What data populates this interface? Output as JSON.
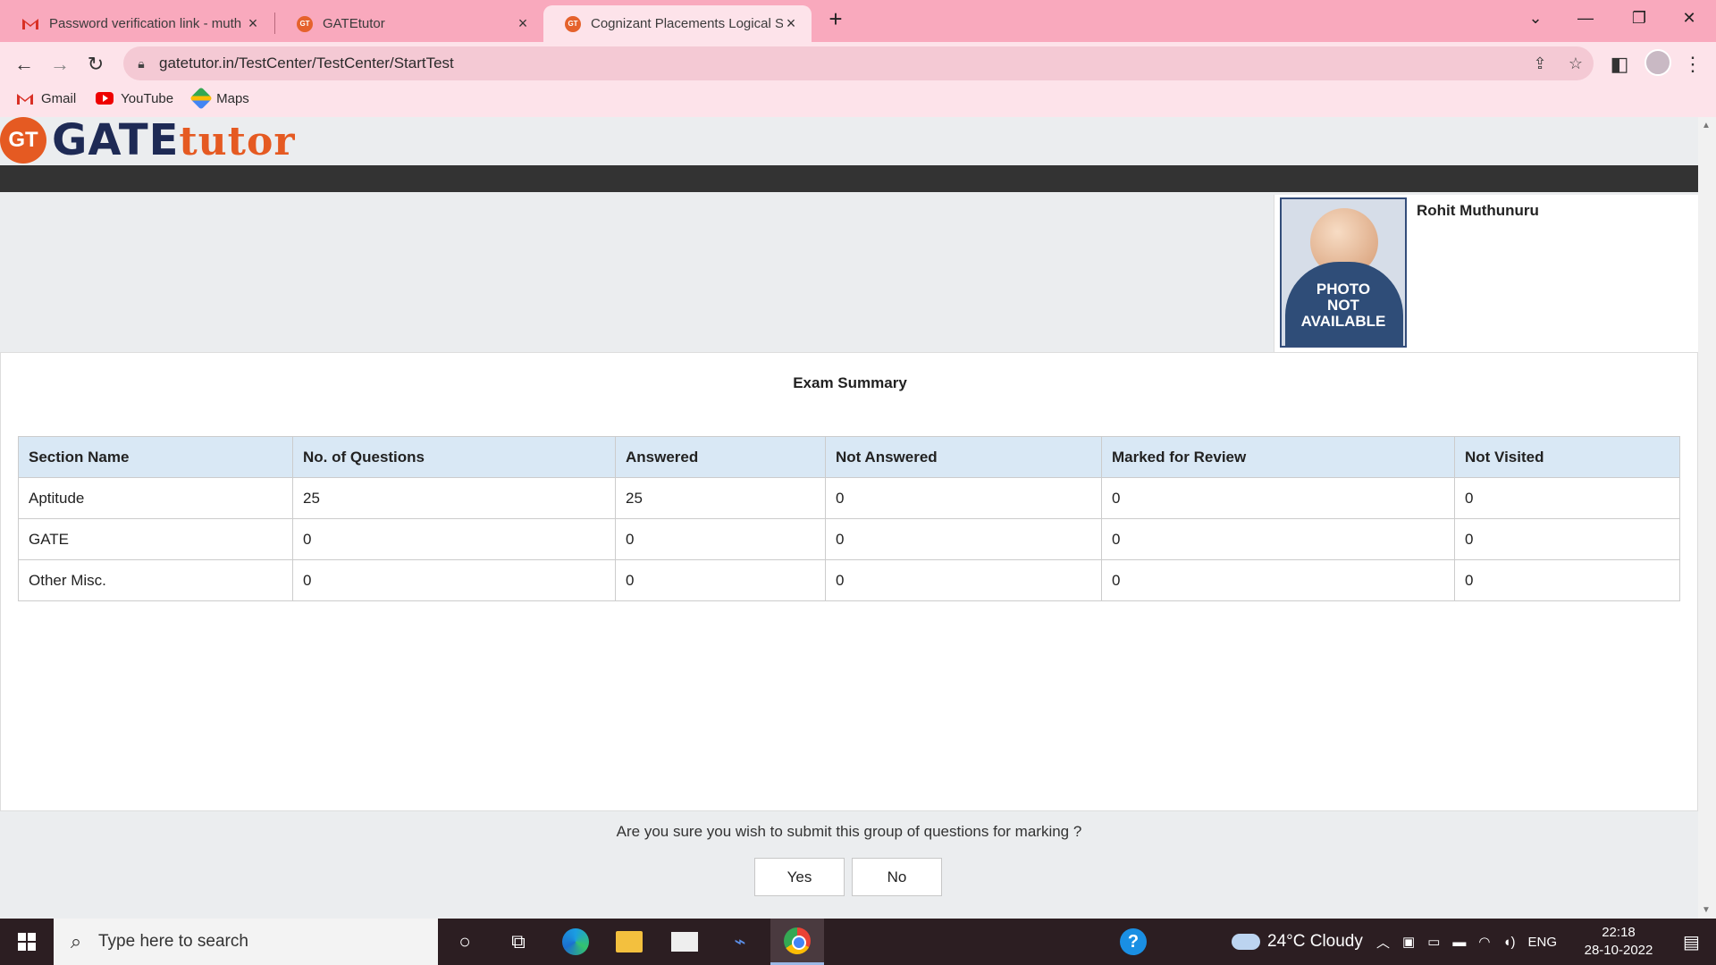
{
  "browser": {
    "tabs": [
      {
        "title": "Password verification link - muth",
        "icon": "gmail-icon",
        "active": false
      },
      {
        "title": "GATEtutor",
        "icon": "gatetutor-icon",
        "active": false
      },
      {
        "title": "Cognizant Placements Logical Sa",
        "icon": "gatetutor-icon",
        "active": true
      }
    ],
    "url": "gatetutor.in/TestCenter/TestCenter/StartTest",
    "bookmarks": [
      {
        "label": "Gmail",
        "icon": "gmail-icon"
      },
      {
        "label": "YouTube",
        "icon": "youtube-icon"
      },
      {
        "label": "Maps",
        "icon": "maps-icon"
      }
    ]
  },
  "site": {
    "logo_badge": "GT",
    "logo_main": "GATE",
    "logo_accent": "tutor"
  },
  "candidate": {
    "name": "Rohit Muthunuru",
    "photo_text_1": "PHOTO",
    "photo_text_2": "NOT",
    "photo_text_3": "AVAILABLE"
  },
  "summary": {
    "title": "Exam Summary",
    "columns": [
      "Section Name",
      "No. of Questions",
      "Answered",
      "Not Answered",
      "Marked for Review",
      "Not Visited"
    ],
    "rows": [
      [
        "Aptitude",
        "25",
        "25",
        "0",
        "0",
        "0"
      ],
      [
        "GATE",
        "0",
        "0",
        "0",
        "0",
        "0"
      ],
      [
        "Other Misc.",
        "0",
        "0",
        "0",
        "0",
        "0"
      ]
    ]
  },
  "confirm": {
    "question": "Are you sure you wish to submit this group of questions for marking ?",
    "yes_label": "Yes",
    "no_label": "No"
  },
  "taskbar": {
    "search_placeholder": "Type here to search",
    "weather": "24°C Cloudy",
    "language": "ENG",
    "time": "22:18",
    "date": "28-10-2022"
  }
}
